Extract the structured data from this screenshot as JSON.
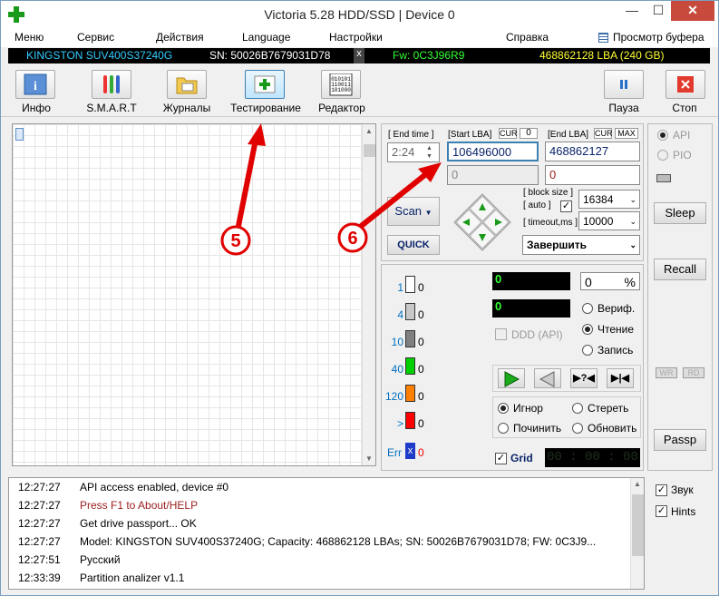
{
  "window": {
    "title": "Victoria 5.28 HDD/SSD | Device 0"
  },
  "menu": {
    "items": [
      "Меню",
      "Сервис",
      "Действия",
      "Language",
      "Настройки",
      "Справка"
    ],
    "buffer_view": "Просмотр буфера"
  },
  "info": {
    "model": "KINGSTON SUV400S37240G",
    "serial": "SN: 50026B7679031D78",
    "fw": "Fw: 0C3J96R9",
    "lba": "468862128 LBA (240 GB)"
  },
  "toolbar": {
    "info": "Инфо",
    "smart": "S.M.A.R.T",
    "logs": "Журналы",
    "test": "Тестирование",
    "editor": "Редактор",
    "pause": "Пауза",
    "stop": "Стоп"
  },
  "annotations": {
    "five": "5",
    "six": "6"
  },
  "test": {
    "end_time_label": "[ End time ]",
    "end_time_value": "2:24",
    "start_lba_label": "[Start LBA]",
    "cur": "CUR",
    "zero": "0",
    "start_lba_value": "106496000",
    "start_lba_sub": "0",
    "end_lba_label": "[End LBA]",
    "max": "MAX",
    "end_lba_value": "468862127",
    "end_lba_sub": "0",
    "scan": "Scan",
    "quick": "QUICK",
    "block_size_label": "[ block size ]",
    "auto_label": "[ auto ]",
    "timeout_label": "[ timeout,ms ]",
    "block_size": "16384",
    "timeout": "10000",
    "finish": "Завершить"
  },
  "stats": {
    "rows": [
      {
        "label": "1",
        "value": "0",
        "color": "#ffffff"
      },
      {
        "label": "4",
        "value": "0",
        "color": "#c8c8c8"
      },
      {
        "label": "10",
        "value": "0",
        "color": "#808080"
      },
      {
        "label": "40",
        "value": "0",
        "color": "#00d000"
      },
      {
        "label": "120",
        "value": "0",
        "color": "#ff8000"
      },
      {
        "label": ">",
        "value": "0",
        "color": "#ff0000"
      }
    ],
    "err_label": "Err",
    "err_value": "0",
    "progress_lba": "0",
    "percent": "0",
    "percent_sign": "%",
    "speed": "0",
    "ddd": "DDD (API)",
    "verify": "Вериф.",
    "read": "Чтение",
    "write": "Запись",
    "ignore": "Игнор",
    "erase": "Стереть",
    "repair": "Починить",
    "refresh": "Обновить",
    "grid": "Grid",
    "timer": "00 : 00 : 00"
  },
  "right": {
    "api": "API",
    "pio": "PIO",
    "sleep": "Sleep",
    "recall": "Recall",
    "wr": "WR",
    "rd": "RD",
    "passp": "Passp",
    "sound": "Звук",
    "hints": "Hints"
  },
  "log": [
    {
      "time": "12:27:27",
      "text": "API access enabled, device #0",
      "color": "#000000"
    },
    {
      "time": "12:27:27",
      "text": "Press F1 to About/HELP",
      "color": "#9b1c1c"
    },
    {
      "time": "12:27:27",
      "text": "Get drive passport... OK",
      "color": "#000000"
    },
    {
      "time": "12:27:27",
      "text": "Model: KINGSTON SUV400S37240G; Capacity: 468862128 LBAs; SN: 50026B7679031D78; FW: 0C3J9...",
      "color": "#000000"
    },
    {
      "time": "12:27:51",
      "text": "Русский",
      "color": "#000000"
    },
    {
      "time": "12:33:39",
      "text": "Partition analizer v1.1",
      "color": "#000000"
    }
  ]
}
